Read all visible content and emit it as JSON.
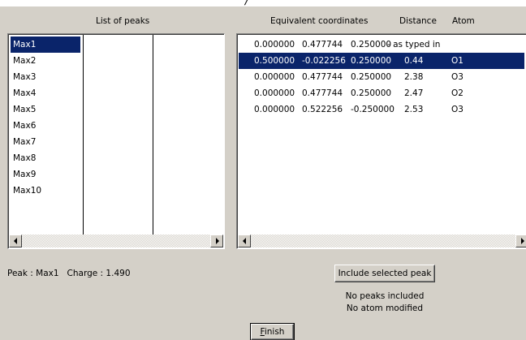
{
  "window": {
    "title_fragment": "/"
  },
  "headers": {
    "list_of_peaks": "List of peaks",
    "equivalent_coordinates": "Equivalent coordinates",
    "distance": "Distance",
    "atom": "Atom"
  },
  "peaks": {
    "selected_index": 0,
    "items": [
      "Max1",
      "Max2",
      "Max3",
      "Max4",
      "Max5",
      "Max6",
      "Max7",
      "Max8",
      "Max9",
      "Max10"
    ]
  },
  "coordinates": {
    "selected_index": 1,
    "rows": [
      {
        "x": "0.000000",
        "y": "0.477744",
        "z": "0.250000",
        "note": "- as typed in",
        "distance": "",
        "atom": ""
      },
      {
        "x": "0.500000",
        "y": "-0.022256",
        "z": "0.250000",
        "note": "",
        "distance": "0.44",
        "atom": "O1"
      },
      {
        "x": "0.000000",
        "y": "0.477744",
        "z": "0.250000",
        "note": "",
        "distance": "2.38",
        "atom": "O3"
      },
      {
        "x": "0.000000",
        "y": "0.477744",
        "z": "0.250000",
        "note": "",
        "distance": "2.47",
        "atom": "O2"
      },
      {
        "x": "0.000000",
        "y": "0.522256",
        "z": "-0.250000",
        "note": "",
        "distance": "2.53",
        "atom": "O3"
      }
    ]
  },
  "peak_info": {
    "text": "Peak : Max1   Charge : 1.490"
  },
  "buttons": {
    "include_label": "Include selected peak",
    "finish_label_underlined": "F",
    "finish_label_rest": "inish"
  },
  "status": {
    "line1": "No peaks included",
    "line2": "No atom modified"
  }
}
